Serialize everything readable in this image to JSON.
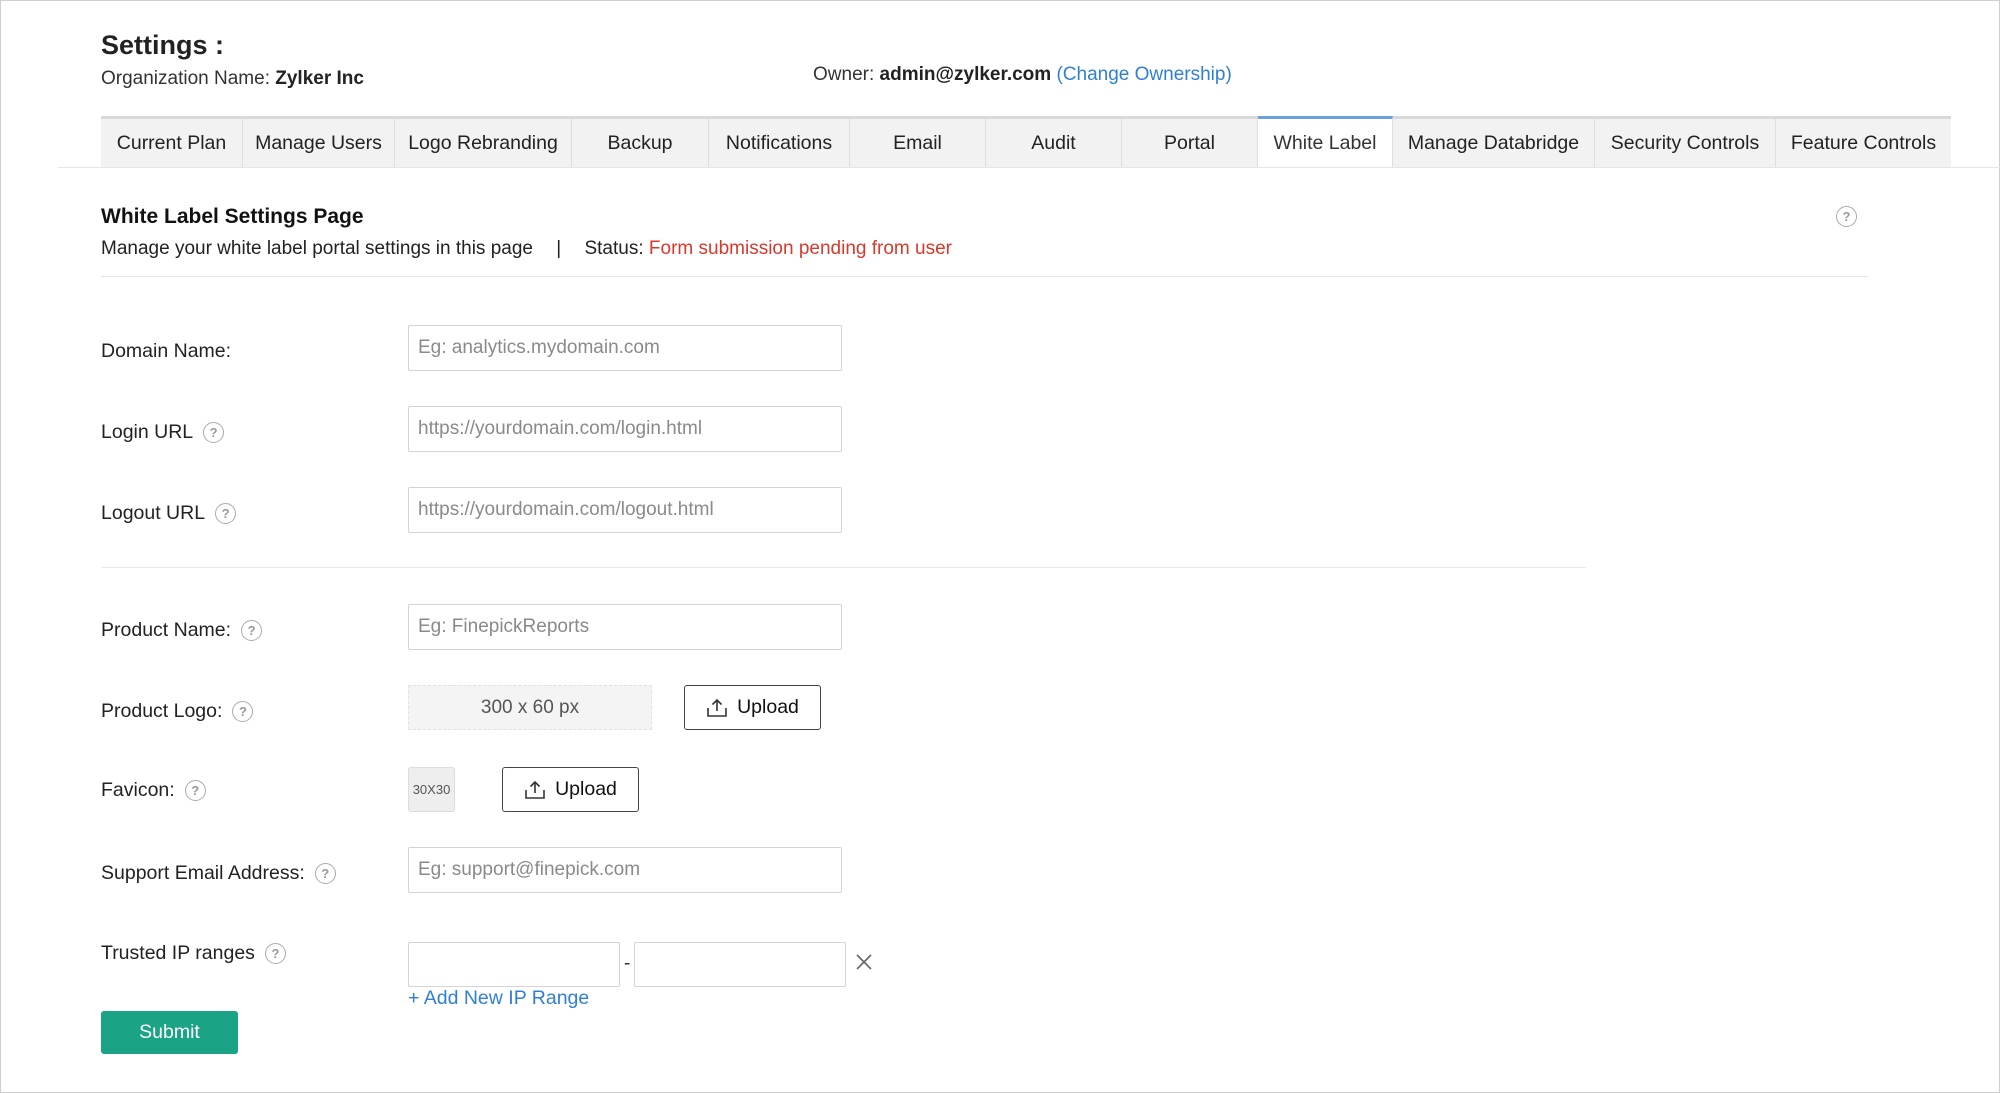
{
  "header": {
    "title": "Settings :",
    "org_label": "Organization Name:",
    "org_name": "Zylker Inc",
    "owner_label": "Owner:",
    "owner_email": "admin@zylker.com",
    "change_ownership": "(Change Ownership)"
  },
  "tabs": [
    {
      "label": "Current Plan"
    },
    {
      "label": "Manage Users"
    },
    {
      "label": "Logo Rebranding"
    },
    {
      "label": "Backup"
    },
    {
      "label": "Notifications"
    },
    {
      "label": "Email"
    },
    {
      "label": "Audit"
    },
    {
      "label": "Portal"
    },
    {
      "label": "White Label",
      "active": true
    },
    {
      "label": "Manage Databridge"
    },
    {
      "label": "Security Controls"
    },
    {
      "label": "Feature Controls"
    }
  ],
  "section": {
    "title": "White Label Settings Page",
    "subtitle": "Manage your white label portal settings in this page",
    "separator": "|",
    "status_label": "Status:",
    "status_value": "Form submission pending from user"
  },
  "form": {
    "domain_name": {
      "label": "Domain Name:",
      "placeholder": "Eg: analytics.mydomain.com"
    },
    "login_url": {
      "label": "Login URL",
      "placeholder": "https://yourdomain.com/login.html"
    },
    "logout_url": {
      "label": "Logout URL",
      "placeholder": "https://yourdomain.com/logout.html"
    },
    "product_name": {
      "label": "Product Name:",
      "placeholder": "Eg: FinepickReports"
    },
    "product_logo": {
      "label": "Product Logo:",
      "size_hint": "300 x 60 px",
      "upload_label": "Upload"
    },
    "favicon": {
      "label": "Favicon:",
      "size_hint": "30X30",
      "upload_label": "Upload"
    },
    "support_email": {
      "label": "Support Email Address:",
      "placeholder": "Eg: support@finepick.com"
    },
    "trusted_ip": {
      "label": "Trusted IP ranges",
      "dash": "-",
      "add_label": "+ Add New IP Range"
    },
    "submit_label": "Submit"
  },
  "icons": {
    "help": "help-circle-icon",
    "upload": "upload-icon",
    "close": "close-icon"
  },
  "colors": {
    "link": "#2f7fd6",
    "status": "#d9392b",
    "submit": "#1aa385",
    "active_tab_accent": "#6b9fe0"
  }
}
